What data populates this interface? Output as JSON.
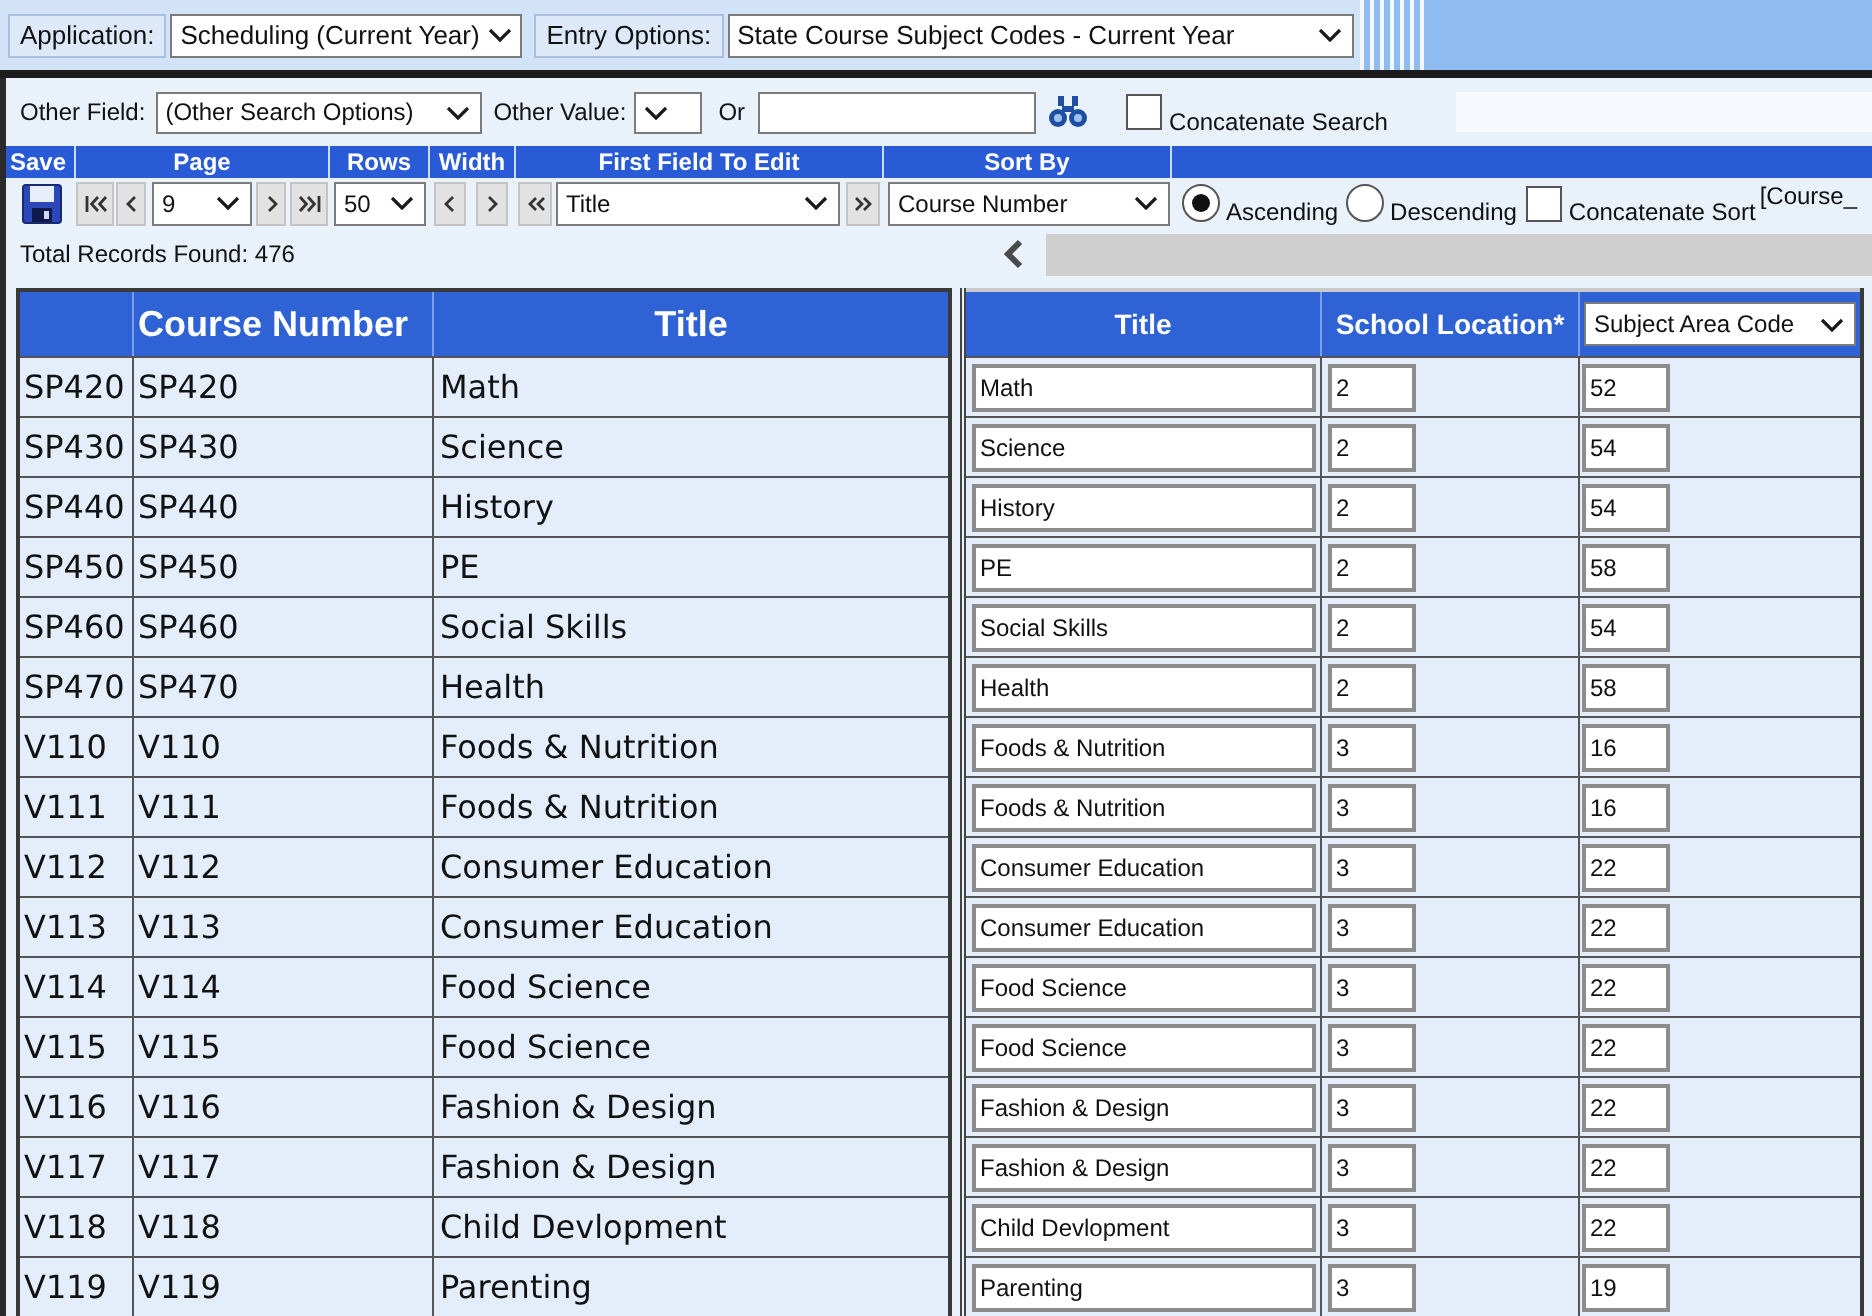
{
  "app_bar": {
    "application_label": "Application:",
    "application": "Scheduling (Current Year)",
    "entry_options_label": "Entry Options:",
    "entry_options": "State Course Subject Codes - Current Year"
  },
  "search_bar": {
    "other_field_label": "Other Field:",
    "other_field": "(Other Search Options)",
    "other_value_label": "Other Value:",
    "or_label": "Or",
    "concatenate_search": {
      "label": "Concatenate Search",
      "checked": false
    }
  },
  "toolbar": {
    "headers": [
      "Save",
      "Page",
      "Rows",
      "Width",
      "First Field To Edit",
      "Sort By"
    ],
    "page": "9",
    "rows": "50",
    "first_field": "Title",
    "sort_by": "Course Number",
    "sort_order": [
      {
        "label": "Ascending",
        "selected": true
      },
      {
        "label": "Descending",
        "selected": false
      }
    ],
    "concatenate_sort": {
      "label": "Concatenate Sort",
      "checked": false
    },
    "sort_expression": "[Course_"
  },
  "total_records": {
    "label": "Total Records Found:",
    "value": "476"
  },
  "left_table": {
    "columns": [
      "Course Number",
      "Title"
    ],
    "rows": [
      {
        "key": "SP420",
        "course_number": "SP420",
        "title": "Math"
      },
      {
        "key": "SP430",
        "course_number": "SP430",
        "title": "Science"
      },
      {
        "key": "SP440",
        "course_number": "SP440",
        "title": "History"
      },
      {
        "key": "SP450",
        "course_number": "SP450",
        "title": "PE"
      },
      {
        "key": "SP460",
        "course_number": "SP460",
        "title": "Social Skills"
      },
      {
        "key": "SP470",
        "course_number": "SP470",
        "title": "Health"
      },
      {
        "key": "V110",
        "course_number": "V110",
        "title": "Foods & Nutrition"
      },
      {
        "key": "V111",
        "course_number": "V111",
        "title": "Foods & Nutrition"
      },
      {
        "key": "V112",
        "course_number": "V112",
        "title": "Consumer Education"
      },
      {
        "key": "V113",
        "course_number": "V113",
        "title": "Consumer Education"
      },
      {
        "key": "V114",
        "course_number": "V114",
        "title": "Food Science"
      },
      {
        "key": "V115",
        "course_number": "V115",
        "title": "Food Science"
      },
      {
        "key": "V116",
        "course_number": "V116",
        "title": "Fashion & Design"
      },
      {
        "key": "V117",
        "course_number": "V117",
        "title": "Fashion & Design"
      },
      {
        "key": "V118",
        "course_number": "V118",
        "title": "Child Devlopment"
      },
      {
        "key": "V119",
        "course_number": "V119",
        "title": "Parenting"
      }
    ]
  },
  "right_table": {
    "columns": [
      "Title",
      "School Location*"
    ],
    "column_select": "Subject Area Code",
    "rows": [
      {
        "title": "Math",
        "school_location": "2",
        "subject_area_code": "52"
      },
      {
        "title": "Science",
        "school_location": "2",
        "subject_area_code": "54"
      },
      {
        "title": "History",
        "school_location": "2",
        "subject_area_code": "54"
      },
      {
        "title": "PE",
        "school_location": "2",
        "subject_area_code": "58"
      },
      {
        "title": "Social Skills",
        "school_location": "2",
        "subject_area_code": "54"
      },
      {
        "title": "Health",
        "school_location": "2",
        "subject_area_code": "58"
      },
      {
        "title": "Foods & Nutrition",
        "school_location": "3",
        "subject_area_code": "16"
      },
      {
        "title": "Foods & Nutrition",
        "school_location": "3",
        "subject_area_code": "16"
      },
      {
        "title": "Consumer Education",
        "school_location": "3",
        "subject_area_code": "22"
      },
      {
        "title": "Consumer Education",
        "school_location": "3",
        "subject_area_code": "22"
      },
      {
        "title": "Food Science",
        "school_location": "3",
        "subject_area_code": "22"
      },
      {
        "title": "Food Science",
        "school_location": "3",
        "subject_area_code": "22"
      },
      {
        "title": "Fashion & Design",
        "school_location": "3",
        "subject_area_code": "22"
      },
      {
        "title": "Fashion & Design",
        "school_location": "3",
        "subject_area_code": "22"
      },
      {
        "title": "Child Devlopment",
        "school_location": "3",
        "subject_area_code": "22"
      },
      {
        "title": "Parenting",
        "school_location": "3",
        "subject_area_code": "19"
      }
    ]
  }
}
